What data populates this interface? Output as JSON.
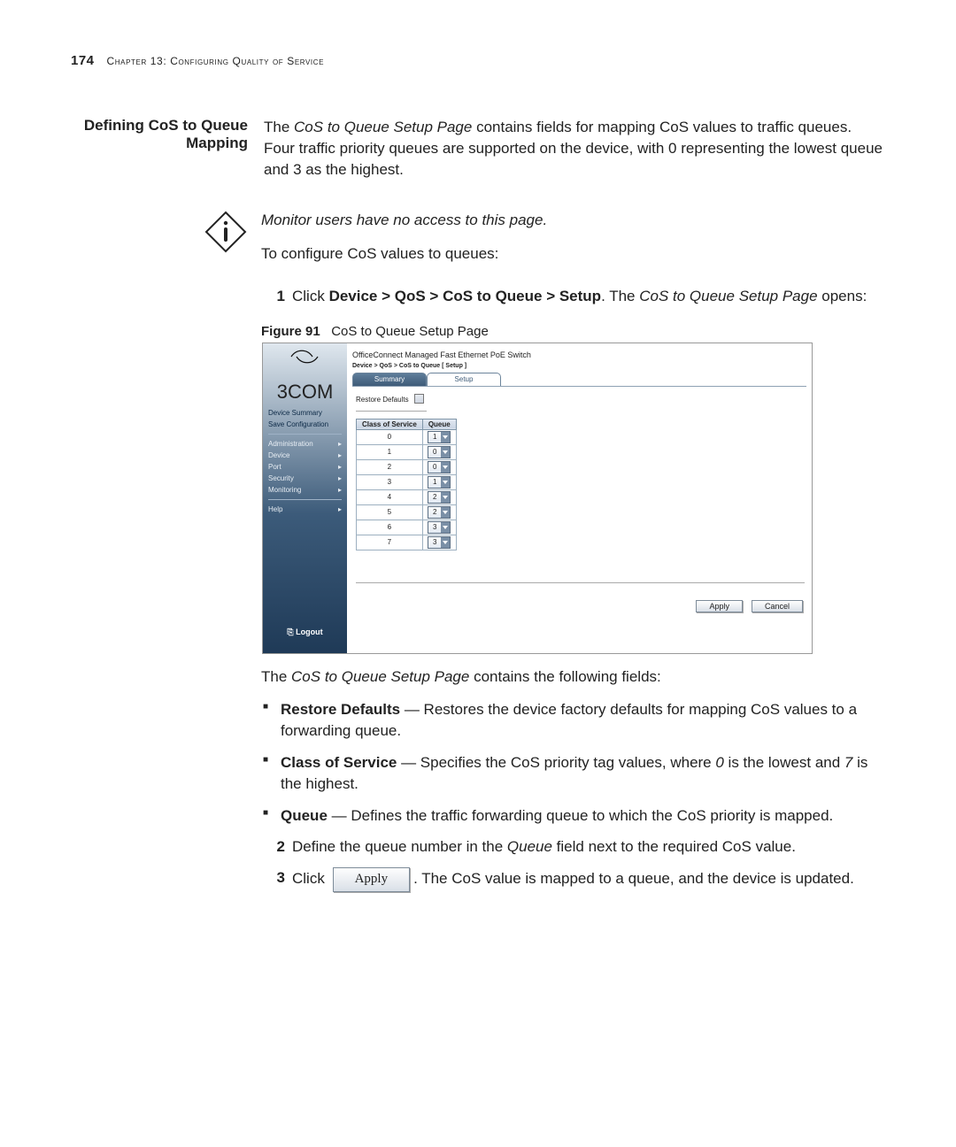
{
  "page": {
    "number": "174",
    "chapter_label": "Chapter 13: Configuring Quality of Service"
  },
  "section_heading": "Defining CoS to Queue Mapping",
  "intro": {
    "t1a": "The ",
    "t1b": "CoS to Queue Setup Page",
    "t1c": " contains fields for mapping CoS values to traffic queues. Four traffic priority queues are supported on the device, with 0 representing the lowest queue and 3 as the highest."
  },
  "note": "Monitor users have no access to this page.",
  "lead_in": "To configure CoS values to queues:",
  "step1": {
    "num": "1",
    "a": "Click ",
    "b": "Device > QoS > CoS to Queue > Setup",
    "c": ". The ",
    "d": "CoS to Queue Setup Page",
    "e": " opens:"
  },
  "figure": {
    "label": "Figure 91",
    "caption": "CoS to Queue Setup Page"
  },
  "shot": {
    "product": "OfficeConnect Managed Fast Ethernet PoE Switch",
    "breadcrumb": "Device > QoS > CoS to Queue [ Setup ]",
    "logo": "3COM",
    "nav_top": [
      "Device Summary",
      "Save Configuration"
    ],
    "nav_main": [
      "Administration",
      "Device",
      "Port",
      "Security",
      "Monitoring"
    ],
    "nav_help": "Help",
    "logout": "Logout",
    "tabs": {
      "summary": "Summary",
      "setup": "Setup"
    },
    "restore_label": "Restore Defaults",
    "th_cos": "Class of Service",
    "th_q": "Queue",
    "rows": [
      {
        "cos": "0",
        "q": "1"
      },
      {
        "cos": "1",
        "q": "0"
      },
      {
        "cos": "2",
        "q": "0"
      },
      {
        "cos": "3",
        "q": "1"
      },
      {
        "cos": "4",
        "q": "2"
      },
      {
        "cos": "5",
        "q": "2"
      },
      {
        "cos": "6",
        "q": "3"
      },
      {
        "cos": "7",
        "q": "3"
      }
    ],
    "apply": "Apply",
    "cancel": "Cancel"
  },
  "post_fig": {
    "a": "The ",
    "b": "CoS to Queue Setup Page",
    "c": " contains the following fields:"
  },
  "bullets": {
    "restore_l": "Restore Defaults",
    "restore_t": " — Restores the device factory defaults for mapping CoS values to a forwarding queue.",
    "cos_l": "Class of Service",
    "cos_t1": " — Specifies the CoS priority tag values, where ",
    "cos_t2": "0",
    "cos_t3": " is the lowest and ",
    "cos_t4": "7",
    "cos_t5": " is the highest.",
    "q_l": "Queue",
    "q_t": " — Defines the traffic forwarding queue to which the CoS priority is mapped."
  },
  "step2": {
    "num": "2",
    "a": "Define the queue number in the ",
    "b": "Queue",
    "c": " field next to the required CoS value."
  },
  "step3": {
    "num": "3",
    "a": "Click ",
    "btn": "Apply",
    "b": ". The CoS value is mapped to a queue, and the device is updated."
  }
}
